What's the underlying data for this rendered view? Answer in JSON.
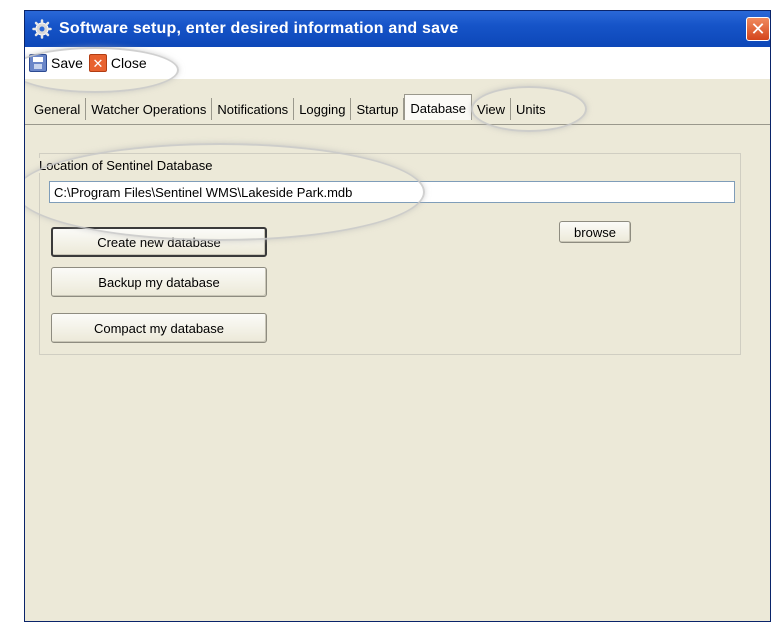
{
  "window": {
    "title": "Software setup, enter desired information and save",
    "title_icon": "gear-icon",
    "close_glyph": "✕"
  },
  "toolbar": {
    "save_label": "Save",
    "close_label": "Close"
  },
  "tabs": [
    {
      "label": "General"
    },
    {
      "label": "Watcher Operations"
    },
    {
      "label": "Notifications"
    },
    {
      "label": "Logging"
    },
    {
      "label": "Startup"
    },
    {
      "label": "Database",
      "active": true
    },
    {
      "label": "View"
    },
    {
      "label": "Units"
    }
  ],
  "database": {
    "group_label": "Location of Sentinel Database",
    "path_value": "C:\\Program Files\\Sentinel WMS\\Lakeside Park.mdb",
    "create_label": "Create new database",
    "backup_label": "Backup my database",
    "compact_label": "Compact my database",
    "browse_label": "browse"
  },
  "colors": {
    "titlebar": "#1654c8",
    "window_bg": "#ece9d8",
    "close_button": "#e8622f"
  }
}
